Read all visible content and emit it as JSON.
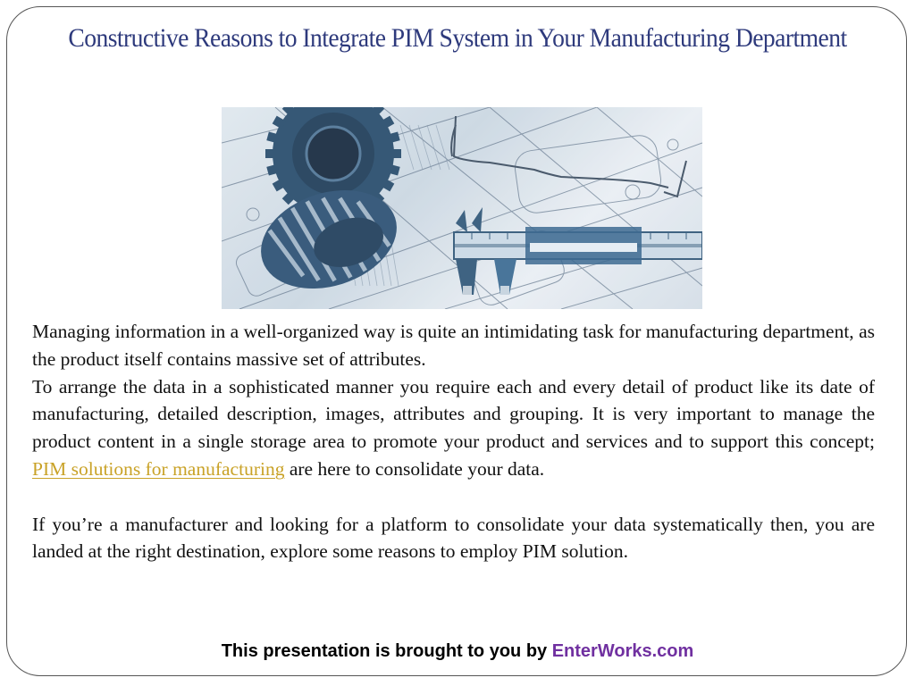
{
  "slide": {
    "title": "Constructive Reasons to Integrate PIM System in Your Manufacturing Department",
    "image": {
      "icon": "gears-calipers-blueprint-photo",
      "alt": "Gears and calipers on engineering blueprint"
    },
    "paragraphs": {
      "p1": "Managing information in a well-organized way is quite an intimidating task for manufacturing department, as the product itself  contains massive set of  attributes.",
      "p2_before_link": "To arrange the data in a sophisticated manner you require each and every detail of  product like its date of  manufacturing, detailed description, images, attributes and grouping. It is very important to manage the product content in a single storage area to promote your product and services and to support this concept; ",
      "p2_link": "PIM solutions for manufacturing",
      "p2_after_link": " are here to consolidate your data.",
      "p3": "If  you’re a manufacturer and looking for a platform to consolidate your data systematically then, you are landed at the right destination, explore some reasons to employ PIM solution."
    },
    "footer": {
      "prefix": "This presentation is brought to you by ",
      "brand": "EnterWorks.com"
    },
    "colors": {
      "title": "#2e3a7c",
      "link": "#c9a227",
      "brand": "#7030a0",
      "body_text": "#111111"
    }
  }
}
